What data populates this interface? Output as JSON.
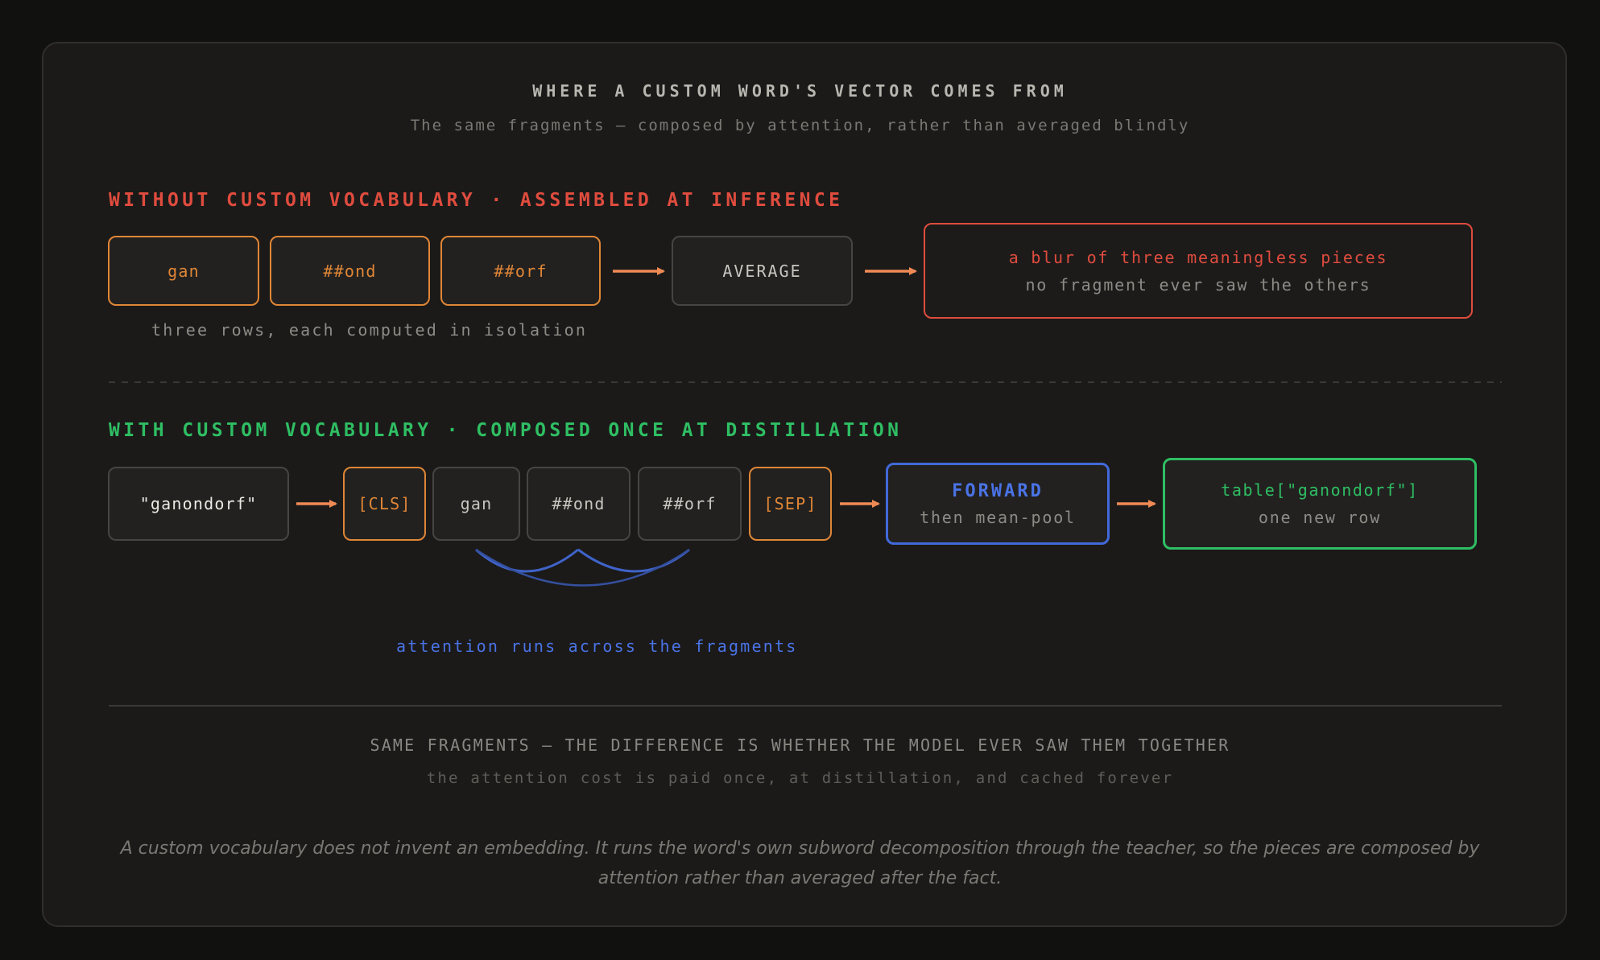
{
  "header": {
    "title": "WHERE A CUSTOM WORD'S VECTOR COMES FROM",
    "subtitle": "The same fragments — composed by attention, rather than averaged blindly"
  },
  "without": {
    "heading": "WITHOUT CUSTOM VOCABULARY · ASSEMBLED AT INFERENCE",
    "tokens": [
      "gan",
      "##ond",
      "##orf"
    ],
    "average_label": "AVERAGE",
    "result_title": "a blur of three meaningless pieces",
    "result_sub": "no fragment ever saw the others",
    "caption": "three rows, each computed in isolation"
  },
  "with": {
    "heading": "WITH CUSTOM VOCABULARY · COMPOSED ONCE AT DISTILLATION",
    "word": "\"ganondorf\"",
    "tokens": [
      "[CLS]",
      "gan",
      "##ond",
      "##orf",
      "[SEP]"
    ],
    "forward_title": "FORWARD",
    "forward_sub": "then mean-pool",
    "result_title": "table[\"ganondorf\"]",
    "result_sub": "one new row",
    "attention_caption": "attention runs across the fragments"
  },
  "footer": {
    "line1": "SAME FRAGMENTS — THE DIFFERENCE IS WHETHER THE MODEL EVER SAW THEM TOGETHER",
    "line2": "the attention cost is paid once, at distillation, and cached forever",
    "note": "A custom vocabulary does not invent an embedding. It runs the word's own subword decomposition through the teacher, so the pieces are composed by attention rather than averaged after the fact."
  },
  "colors": {
    "red": "#df4c3e",
    "orange": "#e08636",
    "arrow": "#f08a55",
    "blue": "#4169d9",
    "green": "#2fbe63"
  }
}
